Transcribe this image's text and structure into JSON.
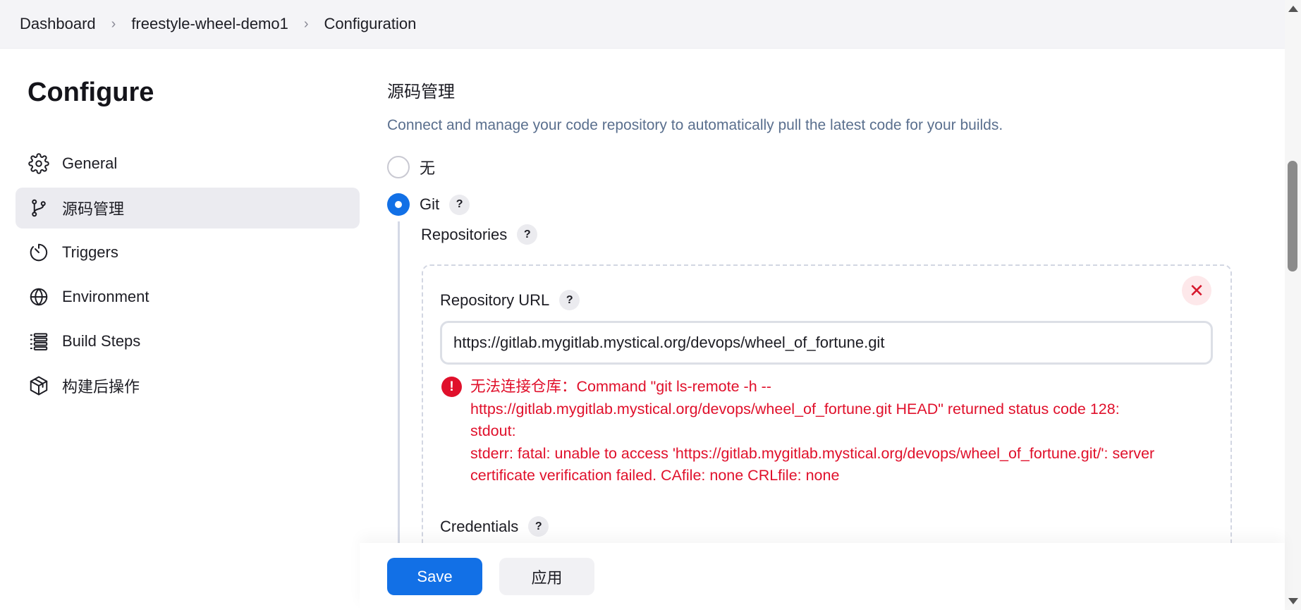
{
  "breadcrumb": {
    "items": [
      "Dashboard",
      "freestyle-wheel-demo1",
      "Configuration"
    ]
  },
  "sidebar": {
    "title": "Configure",
    "items": [
      {
        "label": "General",
        "icon": "gear-icon"
      },
      {
        "label": "源码管理",
        "icon": "git-branch-icon",
        "active": true
      },
      {
        "label": "Triggers",
        "icon": "timer-icon"
      },
      {
        "label": "Environment",
        "icon": "globe-icon"
      },
      {
        "label": "Build Steps",
        "icon": "list-icon"
      },
      {
        "label": "构建后操作",
        "icon": "package-icon"
      }
    ]
  },
  "scm": {
    "title": "源码管理",
    "description": "Connect and manage your code repository to automatically pull the latest code for your builds.",
    "options": [
      {
        "label": "无",
        "checked": false
      },
      {
        "label": "Git",
        "checked": true
      }
    ],
    "help_glyph": "?",
    "repositories_label": "Repositories",
    "repository_url_label": "Repository URL",
    "repository_url_value": "https://gitlab.mygitlab.mystical.org/devops/wheel_of_fortune.git",
    "error_icon_glyph": "!",
    "close_glyph": "✕",
    "error_lines": [
      "无法连接仓库：Command \"git ls-remote -h --",
      "https://gitlab.mygitlab.mystical.org/devops/wheel_of_fortune.git HEAD\" returned status code 128:",
      "stdout:",
      "stderr: fatal: unable to access 'https://gitlab.mygitlab.mystical.org/devops/wheel_of_fortune.git/': server",
      "certificate verification failed. CAfile: none CRLfile: none"
    ],
    "credentials_label": "Credentials"
  },
  "actions": {
    "save_label": "Save",
    "apply_label": "应用"
  },
  "colors": {
    "accent": "#1270e6",
    "error": "#e0102b",
    "sidebar_active": "#ebebf0"
  }
}
